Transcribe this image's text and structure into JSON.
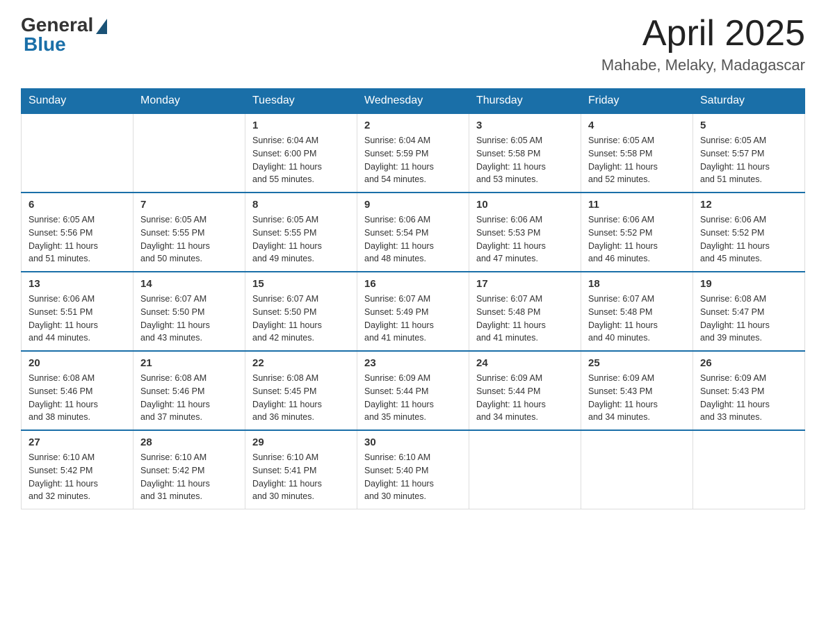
{
  "header": {
    "logo_general": "General",
    "logo_blue": "Blue",
    "month_title": "April 2025",
    "location": "Mahabe, Melaky, Madagascar"
  },
  "days_of_week": [
    "Sunday",
    "Monday",
    "Tuesday",
    "Wednesday",
    "Thursday",
    "Friday",
    "Saturday"
  ],
  "weeks": [
    [
      {
        "day": "",
        "info": ""
      },
      {
        "day": "",
        "info": ""
      },
      {
        "day": "1",
        "info": "Sunrise: 6:04 AM\nSunset: 6:00 PM\nDaylight: 11 hours\nand 55 minutes."
      },
      {
        "day": "2",
        "info": "Sunrise: 6:04 AM\nSunset: 5:59 PM\nDaylight: 11 hours\nand 54 minutes."
      },
      {
        "day": "3",
        "info": "Sunrise: 6:05 AM\nSunset: 5:58 PM\nDaylight: 11 hours\nand 53 minutes."
      },
      {
        "day": "4",
        "info": "Sunrise: 6:05 AM\nSunset: 5:58 PM\nDaylight: 11 hours\nand 52 minutes."
      },
      {
        "day": "5",
        "info": "Sunrise: 6:05 AM\nSunset: 5:57 PM\nDaylight: 11 hours\nand 51 minutes."
      }
    ],
    [
      {
        "day": "6",
        "info": "Sunrise: 6:05 AM\nSunset: 5:56 PM\nDaylight: 11 hours\nand 51 minutes."
      },
      {
        "day": "7",
        "info": "Sunrise: 6:05 AM\nSunset: 5:55 PM\nDaylight: 11 hours\nand 50 minutes."
      },
      {
        "day": "8",
        "info": "Sunrise: 6:05 AM\nSunset: 5:55 PM\nDaylight: 11 hours\nand 49 minutes."
      },
      {
        "day": "9",
        "info": "Sunrise: 6:06 AM\nSunset: 5:54 PM\nDaylight: 11 hours\nand 48 minutes."
      },
      {
        "day": "10",
        "info": "Sunrise: 6:06 AM\nSunset: 5:53 PM\nDaylight: 11 hours\nand 47 minutes."
      },
      {
        "day": "11",
        "info": "Sunrise: 6:06 AM\nSunset: 5:52 PM\nDaylight: 11 hours\nand 46 minutes."
      },
      {
        "day": "12",
        "info": "Sunrise: 6:06 AM\nSunset: 5:52 PM\nDaylight: 11 hours\nand 45 minutes."
      }
    ],
    [
      {
        "day": "13",
        "info": "Sunrise: 6:06 AM\nSunset: 5:51 PM\nDaylight: 11 hours\nand 44 minutes."
      },
      {
        "day": "14",
        "info": "Sunrise: 6:07 AM\nSunset: 5:50 PM\nDaylight: 11 hours\nand 43 minutes."
      },
      {
        "day": "15",
        "info": "Sunrise: 6:07 AM\nSunset: 5:50 PM\nDaylight: 11 hours\nand 42 minutes."
      },
      {
        "day": "16",
        "info": "Sunrise: 6:07 AM\nSunset: 5:49 PM\nDaylight: 11 hours\nand 41 minutes."
      },
      {
        "day": "17",
        "info": "Sunrise: 6:07 AM\nSunset: 5:48 PM\nDaylight: 11 hours\nand 41 minutes."
      },
      {
        "day": "18",
        "info": "Sunrise: 6:07 AM\nSunset: 5:48 PM\nDaylight: 11 hours\nand 40 minutes."
      },
      {
        "day": "19",
        "info": "Sunrise: 6:08 AM\nSunset: 5:47 PM\nDaylight: 11 hours\nand 39 minutes."
      }
    ],
    [
      {
        "day": "20",
        "info": "Sunrise: 6:08 AM\nSunset: 5:46 PM\nDaylight: 11 hours\nand 38 minutes."
      },
      {
        "day": "21",
        "info": "Sunrise: 6:08 AM\nSunset: 5:46 PM\nDaylight: 11 hours\nand 37 minutes."
      },
      {
        "day": "22",
        "info": "Sunrise: 6:08 AM\nSunset: 5:45 PM\nDaylight: 11 hours\nand 36 minutes."
      },
      {
        "day": "23",
        "info": "Sunrise: 6:09 AM\nSunset: 5:44 PM\nDaylight: 11 hours\nand 35 minutes."
      },
      {
        "day": "24",
        "info": "Sunrise: 6:09 AM\nSunset: 5:44 PM\nDaylight: 11 hours\nand 34 minutes."
      },
      {
        "day": "25",
        "info": "Sunrise: 6:09 AM\nSunset: 5:43 PM\nDaylight: 11 hours\nand 34 minutes."
      },
      {
        "day": "26",
        "info": "Sunrise: 6:09 AM\nSunset: 5:43 PM\nDaylight: 11 hours\nand 33 minutes."
      }
    ],
    [
      {
        "day": "27",
        "info": "Sunrise: 6:10 AM\nSunset: 5:42 PM\nDaylight: 11 hours\nand 32 minutes."
      },
      {
        "day": "28",
        "info": "Sunrise: 6:10 AM\nSunset: 5:42 PM\nDaylight: 11 hours\nand 31 minutes."
      },
      {
        "day": "29",
        "info": "Sunrise: 6:10 AM\nSunset: 5:41 PM\nDaylight: 11 hours\nand 30 minutes."
      },
      {
        "day": "30",
        "info": "Sunrise: 6:10 AM\nSunset: 5:40 PM\nDaylight: 11 hours\nand 30 minutes."
      },
      {
        "day": "",
        "info": ""
      },
      {
        "day": "",
        "info": ""
      },
      {
        "day": "",
        "info": ""
      }
    ]
  ]
}
